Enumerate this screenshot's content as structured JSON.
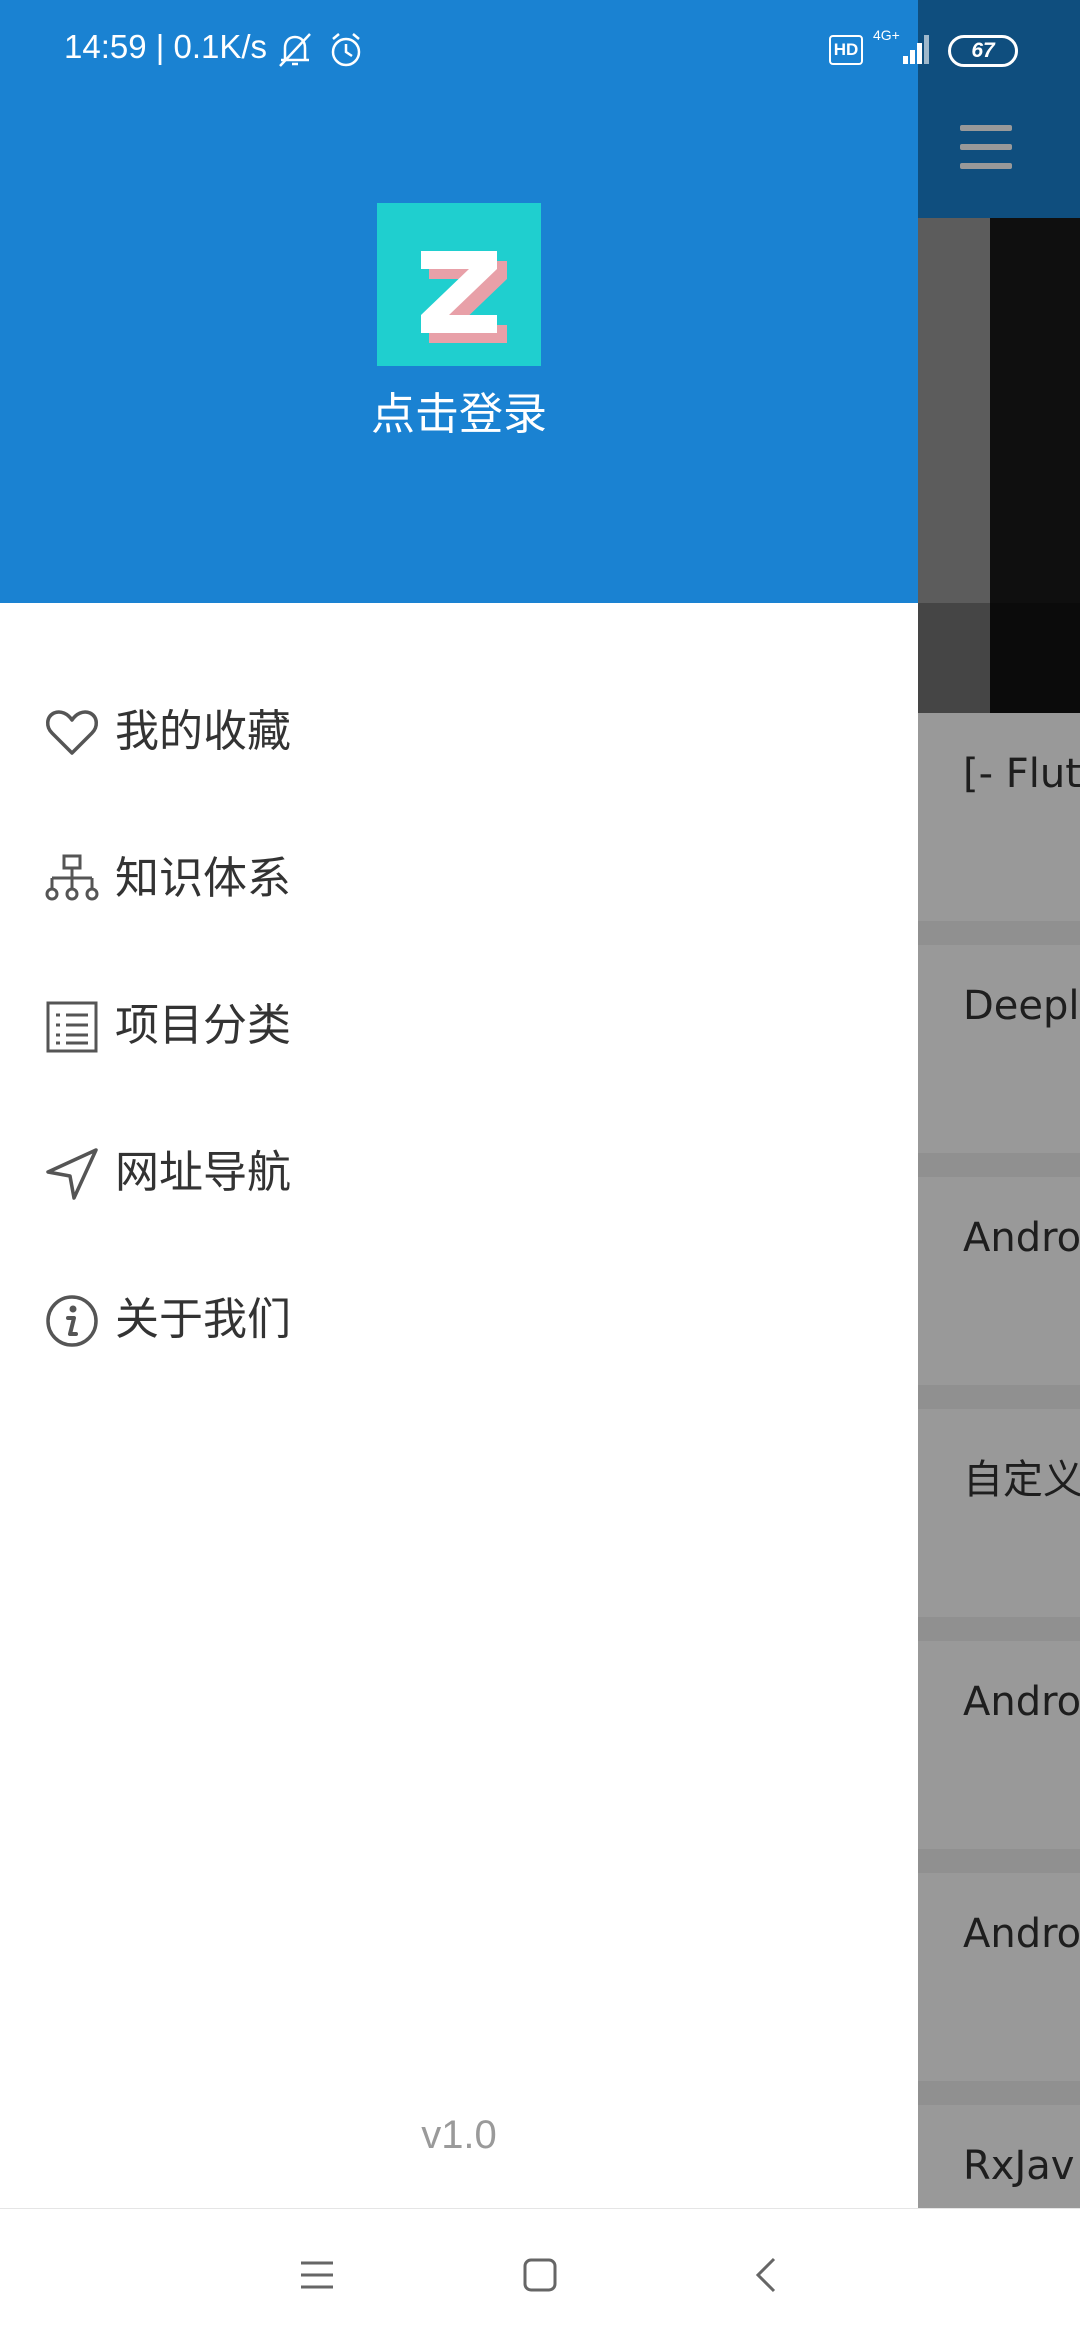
{
  "status_bar": {
    "time_speed": "14:59 | 0.1K/s",
    "hd": "HD",
    "network": "4G+",
    "battery": "67",
    "icons": [
      "bell-off-icon",
      "alarm-icon",
      "signal-icon",
      "battery-icon"
    ]
  },
  "drawer": {
    "login_label": "点击登录",
    "logo_letter": "Z",
    "menu_items": [
      {
        "label": "我的收藏",
        "icon": "heart-icon"
      },
      {
        "label": "知识体系",
        "icon": "sitemap-icon"
      },
      {
        "label": "项目分类",
        "icon": "list-icon"
      },
      {
        "label": "网址导航",
        "icon": "navigation-icon"
      },
      {
        "label": "关于我们",
        "icon": "info-icon"
      }
    ],
    "version": "v1.0"
  },
  "background_list": {
    "titles": [
      "[- Flutt",
      "Deepli",
      "Andro",
      "自定义",
      "Andro",
      "Andro",
      "RxJav"
    ]
  },
  "nav_bar": {
    "buttons": [
      "menu-button",
      "home-button",
      "back-button"
    ]
  },
  "colors": {
    "primary": "#1a82d2",
    "logo_bg": "#1fcfcf",
    "text": "#333333",
    "version_text": "#9a9a9a"
  }
}
